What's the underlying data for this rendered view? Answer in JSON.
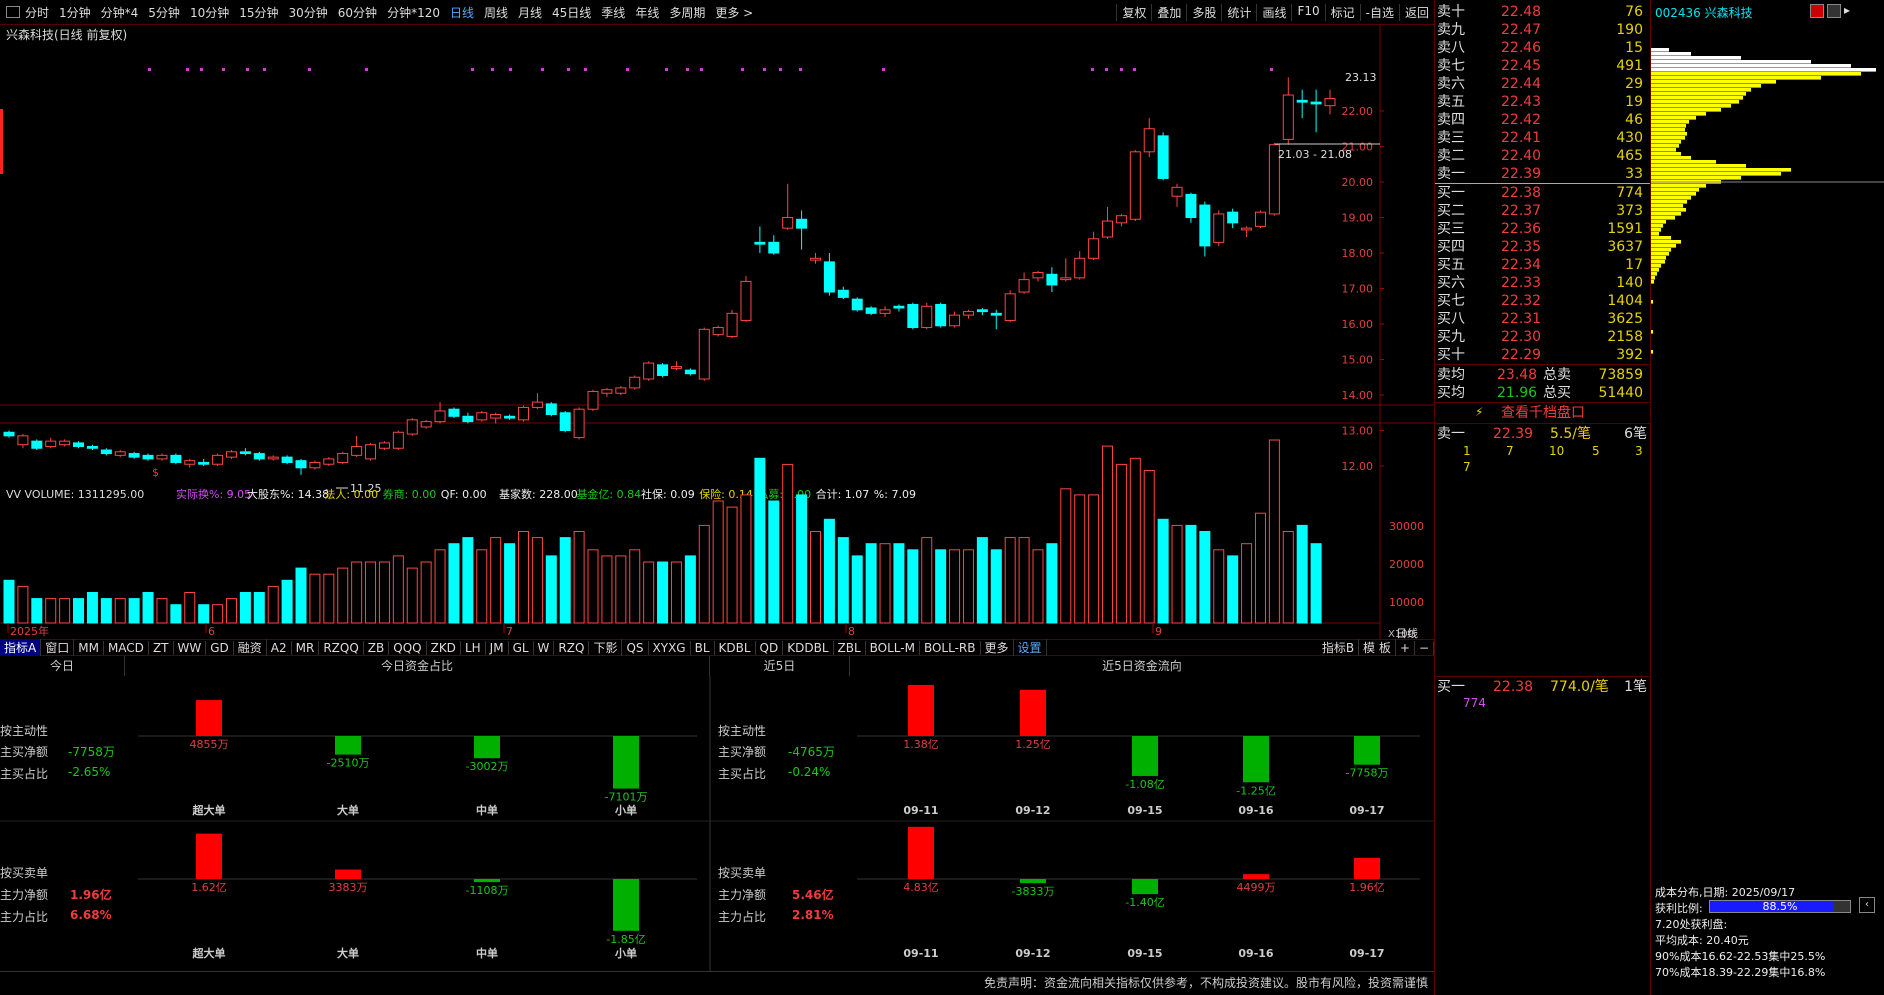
{
  "topbar": {
    "periods": [
      "分时",
      "1分钟",
      "分钟*4",
      "5分钟",
      "10分钟",
      "15分钟",
      "30分钟",
      "60分钟",
      "分钟*120",
      "日线",
      "周线",
      "月线",
      "45日线",
      "季线",
      "年线",
      "多周期",
      "更多 >"
    ],
    "active": "日线",
    "right": [
      "复权",
      "叠加",
      "多股",
      "统计",
      "画线",
      "F10",
      "标记",
      "-自选",
      "返回"
    ]
  },
  "chart": {
    "title": "兴森科技(日线 前复权)",
    "ylabels": [
      "22.00",
      "21.00",
      "20.00",
      "19.00",
      "18.00",
      "17.00",
      "16.00",
      "15.00",
      "14.00",
      "13.00",
      "12.00"
    ],
    "price_max_label": "23.13",
    "price_min_label": "11.25",
    "range_label": "21.03 - 21.08",
    "dollar_marker": "$",
    "vol_ylabels": [
      "30000",
      "20000",
      "10000"
    ],
    "vol_unit": "X100",
    "xlabels": [
      "2025年",
      "6",
      "7",
      "8",
      "9"
    ],
    "period_tag": "日线"
  },
  "indicator": {
    "name": "VV VOLUME: 1311295.00",
    "items": [
      {
        "t": "实际换%: 9.05",
        "c": "mag"
      },
      {
        "t": "大股东%: 14.38",
        "c": "white"
      },
      {
        "t": "法人: 0.00",
        "c": "yel"
      },
      {
        "t": "券商: 0.00",
        "c": "grn"
      },
      {
        "t": "QF: 0.00",
        "c": "white"
      },
      {
        "t": "基家数: 228.00",
        "c": "white"
      },
      {
        "t": "基金亿: 0.84",
        "c": "grn"
      },
      {
        "t": "社保: 0.09",
        "c": "white"
      },
      {
        "t": "保险: 0.14",
        "c": "yel"
      },
      {
        "t": "私募: 0.00",
        "c": "grn"
      },
      {
        "t": "合计: 1.07",
        "c": "white"
      },
      {
        "t": "%: 7.09",
        "c": "white"
      }
    ]
  },
  "tabs": [
    "指标A",
    "窗口",
    "MM",
    "MACD",
    "ZT",
    "WW",
    "GD",
    "融资",
    "A2",
    "MR",
    "RZQQ",
    "ZB",
    "QQQ",
    "ZKD",
    "LH",
    "JM",
    "GL",
    "W",
    "RZQ",
    "下影",
    "QS",
    "XYXG",
    "BL",
    "KDBL",
    "QD",
    "KDDBL",
    "ZBL",
    "BOLL-M",
    "BOLL-RB",
    "更多",
    "设置"
  ],
  "tabs_right": [
    "指标B",
    "模 板",
    "+",
    "−"
  ],
  "fund": {
    "headers": {
      "today": "今日",
      "today_ratio": "今日资金占比",
      "last5": "近5日",
      "last5_flow": "近5日资金流向"
    },
    "today_active": {
      "title": "按主动性",
      "net_label": "主买净额",
      "net": "-7758万",
      "ratio_label": "主买占比",
      "ratio": "-2.65%"
    },
    "today_big": {
      "title": "按买卖单",
      "net_label": "主力净额",
      "net": "1.96亿",
      "ratio_label": "主力占比",
      "ratio": "6.68%"
    },
    "five_active": {
      "title": "按主动性",
      "net_label": "主买净额",
      "net": "-4765万",
      "ratio_label": "主买占比",
      "ratio": "-0.24%"
    },
    "five_big": {
      "title": "按买卖单",
      "net_label": "主力净额",
      "net": "5.46亿",
      "ratio_label": "主力占比",
      "ratio": "2.81%"
    },
    "order_cats": [
      "超大单",
      "大单",
      "中单",
      "小单"
    ],
    "today_bars1": [
      {
        "v": 4855,
        "l": "4855万"
      },
      {
        "v": -2510,
        "l": "-2510万"
      },
      {
        "v": -3002,
        "l": "-3002万"
      },
      {
        "v": -7101,
        "l": "-7101万"
      }
    ],
    "today_bars2": [
      {
        "v": 16200,
        "l": "1.62亿"
      },
      {
        "v": 3383,
        "l": "3383万"
      },
      {
        "v": -1108,
        "l": "-1108万"
      },
      {
        "v": -18500,
        "l": "-1.85亿"
      }
    ],
    "dates": [
      "09-11",
      "09-12",
      "09-15",
      "09-16",
      "09-17"
    ],
    "five_bars1": [
      {
        "v": 13800,
        "l": "1.38亿"
      },
      {
        "v": 12500,
        "l": "1.25亿"
      },
      {
        "v": -10800,
        "l": "-1.08亿"
      },
      {
        "v": -12500,
        "l": "-1.25亿"
      },
      {
        "v": -7758,
        "l": "-7758万"
      }
    ],
    "five_bars2": [
      {
        "v": 48300,
        "l": "4.83亿"
      },
      {
        "v": -3833,
        "l": "-3833万"
      },
      {
        "v": -14000,
        "l": "-1.40亿"
      },
      {
        "v": 4499,
        "l": "4499万"
      },
      {
        "v": 19600,
        "l": "1.96亿"
      }
    ]
  },
  "disclaimer": "免责声明：资金流向相关指标仅供参考，不构成投资建议。股市有风险，投资需谨慎",
  "orderbook": {
    "sells": [
      {
        "n": "卖十",
        "p": "22.48",
        "v": "76"
      },
      {
        "n": "卖九",
        "p": "22.47",
        "v": "190"
      },
      {
        "n": "卖八",
        "p": "22.46",
        "v": "15"
      },
      {
        "n": "卖七",
        "p": "22.45",
        "v": "491"
      },
      {
        "n": "卖六",
        "p": "22.44",
        "v": "29"
      },
      {
        "n": "卖五",
        "p": "22.43",
        "v": "19"
      },
      {
        "n": "卖四",
        "p": "22.42",
        "v": "46"
      },
      {
        "n": "卖三",
        "p": "22.41",
        "v": "430"
      },
      {
        "n": "卖二",
        "p": "22.40",
        "v": "465"
      },
      {
        "n": "卖一",
        "p": "22.39",
        "v": "33"
      }
    ],
    "buys": [
      {
        "n": "买一",
        "p": "22.38",
        "v": "774"
      },
      {
        "n": "买二",
        "p": "22.37",
        "v": "373"
      },
      {
        "n": "买三",
        "p": "22.36",
        "v": "1591"
      },
      {
        "n": "买四",
        "p": "22.35",
        "v": "3637"
      },
      {
        "n": "买五",
        "p": "22.34",
        "v": "17"
      },
      {
        "n": "买六",
        "p": "22.33",
        "v": "140"
      },
      {
        "n": "买七",
        "p": "22.32",
        "v": "1404"
      },
      {
        "n": "买八",
        "p": "22.31",
        "v": "3625"
      },
      {
        "n": "买九",
        "p": "22.30",
        "v": "2158"
      },
      {
        "n": "买十",
        "p": "22.29",
        "v": "392"
      }
    ],
    "avg_sell": {
      "n": "卖均",
      "p": "23.48",
      "tl": "总卖",
      "tv": "73859"
    },
    "avg_buy": {
      "n": "买均",
      "p": "21.96",
      "tl": "总买",
      "tv": "51440"
    },
    "view_btn": "查看千档盘口",
    "sell1_detail": {
      "n": "卖一",
      "p": "22.39",
      "v": "5.5/笔",
      "c": "6笔",
      "orders": [
        "1",
        "7",
        "10",
        "5",
        "3",
        "7"
      ]
    },
    "buy1_detail": {
      "n": "买一",
      "p": "22.38",
      "v": "774.0/笔",
      "c": "1笔",
      "orders": [
        "774"
      ]
    }
  },
  "profile": {
    "code": "002436 兴森科技",
    "date_label": "成本分布,日期: 2025/09/17",
    "profit_label": "获利比例:",
    "profit_value": "88.5%",
    "line1": "7.20处获利盘:",
    "line2": "平均成本: 20.40元",
    "line3": "90%成本16.62-22.53集中25.5%",
    "line4": "70%成本18.39-22.29集中16.8%"
  }
}
